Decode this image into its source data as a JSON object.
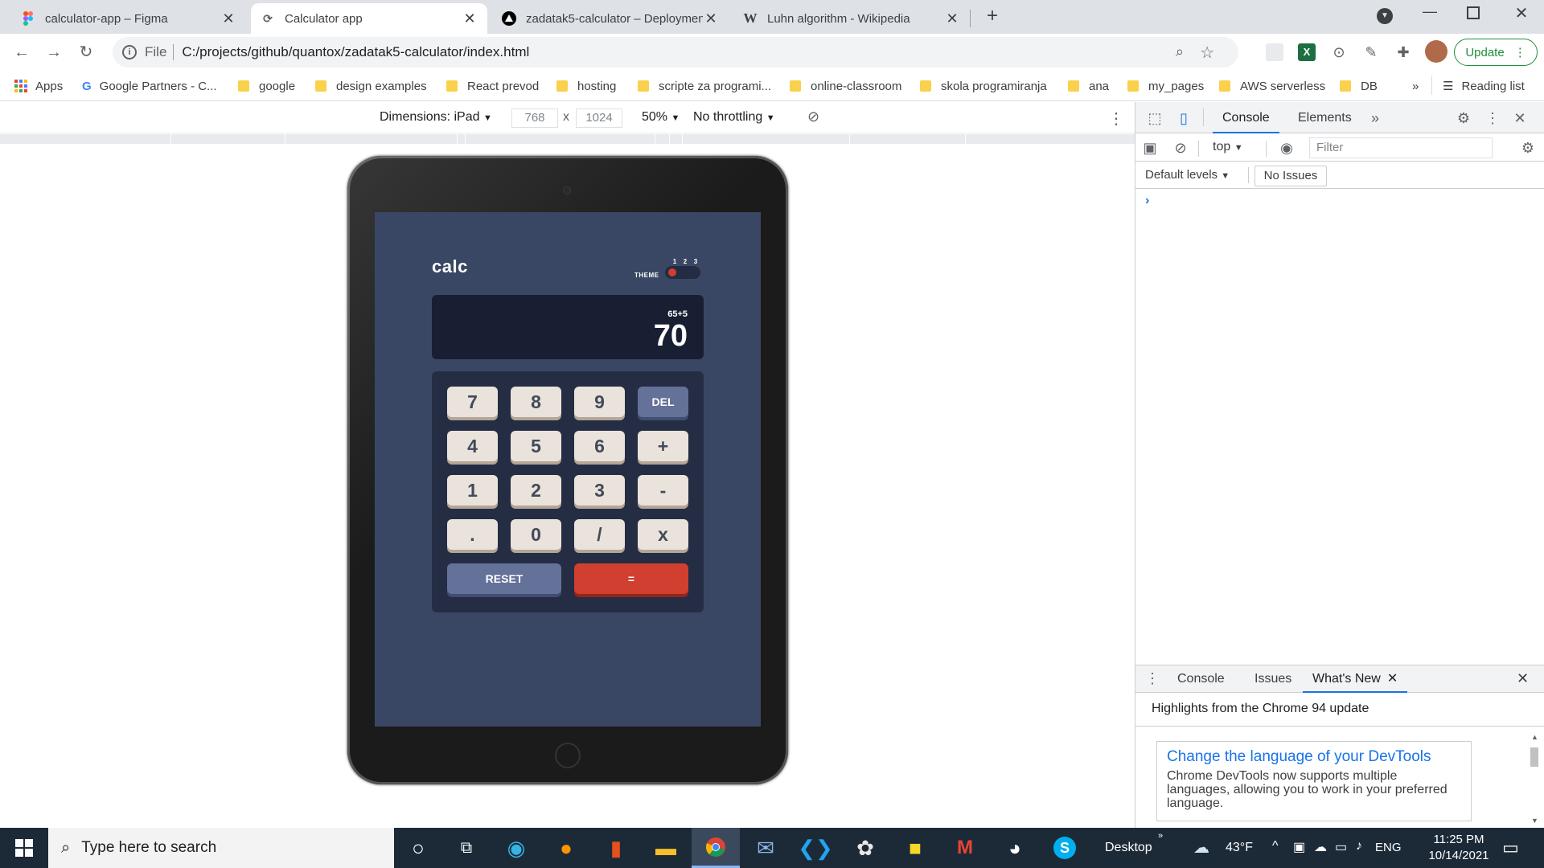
{
  "tabs": [
    {
      "title": "calculator-app – Figma",
      "icon": "figma-icon",
      "active": false
    },
    {
      "title": "Calculator app",
      "icon": "loading-icon",
      "active": true
    },
    {
      "title": "zadatak5-calculator – Deploymen",
      "icon": "vercel-icon",
      "active": false
    },
    {
      "title": "Luhn algorithm - Wikipedia",
      "icon": "wikipedia-icon",
      "active": false
    }
  ],
  "toolbar": {
    "file_label": "File",
    "url": "C:/projects/github/quantox/zadatak5-calculator/index.html",
    "update_label": "Update"
  },
  "bookmarks": [
    {
      "label": "Apps",
      "type": "apps"
    },
    {
      "label": "Google Partners - C...",
      "type": "google"
    },
    {
      "label": "google",
      "type": "folder"
    },
    {
      "label": "design examples",
      "type": "folder"
    },
    {
      "label": "React prevod",
      "type": "folder"
    },
    {
      "label": "hosting",
      "type": "folder"
    },
    {
      "label": "scripte za programi...",
      "type": "folder"
    },
    {
      "label": "online-classroom",
      "type": "folder"
    },
    {
      "label": "skola programiranja",
      "type": "folder"
    },
    {
      "label": "ana",
      "type": "folder"
    },
    {
      "label": "my_pages",
      "type": "folder"
    },
    {
      "label": "AWS serverless",
      "type": "folder"
    },
    {
      "label": "DB",
      "type": "folder"
    }
  ],
  "bookmarks_overflow": "»",
  "reading_list": "Reading list",
  "device_toolbar": {
    "dimensions_label": "Dimensions: iPad",
    "width": "768",
    "times": "x",
    "height": "1024",
    "zoom": "50%",
    "throttling": "No throttling"
  },
  "calculator": {
    "logo": "calc",
    "theme_label": "THEME",
    "theme_numbers": [
      "1",
      "2",
      "3"
    ],
    "active_theme": 1,
    "expression": "65+5",
    "result": "70",
    "keys": [
      [
        "7",
        "8",
        "9",
        "DEL"
      ],
      [
        "4",
        "5",
        "6",
        "+"
      ],
      [
        "1",
        "2",
        "3",
        "-"
      ],
      [
        ".",
        "0",
        "/",
        "x"
      ]
    ],
    "reset_label": "RESET",
    "equals_label": "=",
    "colors": {
      "main_bg": "#3a4764",
      "keypad_bg": "#242d44",
      "display_bg": "#181f33",
      "key_bg": "#eae3dc",
      "key_blue": "#647198",
      "key_red": "#d03f2f"
    }
  },
  "devtools": {
    "tabs": [
      "Console",
      "Elements"
    ],
    "active_tab": "Console",
    "context": "top",
    "filter_placeholder": "Filter",
    "levels": "Default levels",
    "issues": "No Issues",
    "prompt": "›",
    "drawer_tabs": [
      "Console",
      "Issues",
      "What's New"
    ],
    "drawer_active": "What's New",
    "highlights": "Highlights from the Chrome 94 update",
    "card_title": "Change the language of your DevTools",
    "card_body": "Chrome DevTools now supports multiple languages, allowing you to work in your preferred language."
  },
  "taskbar": {
    "search_placeholder": "Type here to search",
    "desktop_label": "Desktop",
    "weather": "43°F",
    "language": "ENG",
    "time": "11:25 PM",
    "date": "10/14/2021"
  }
}
